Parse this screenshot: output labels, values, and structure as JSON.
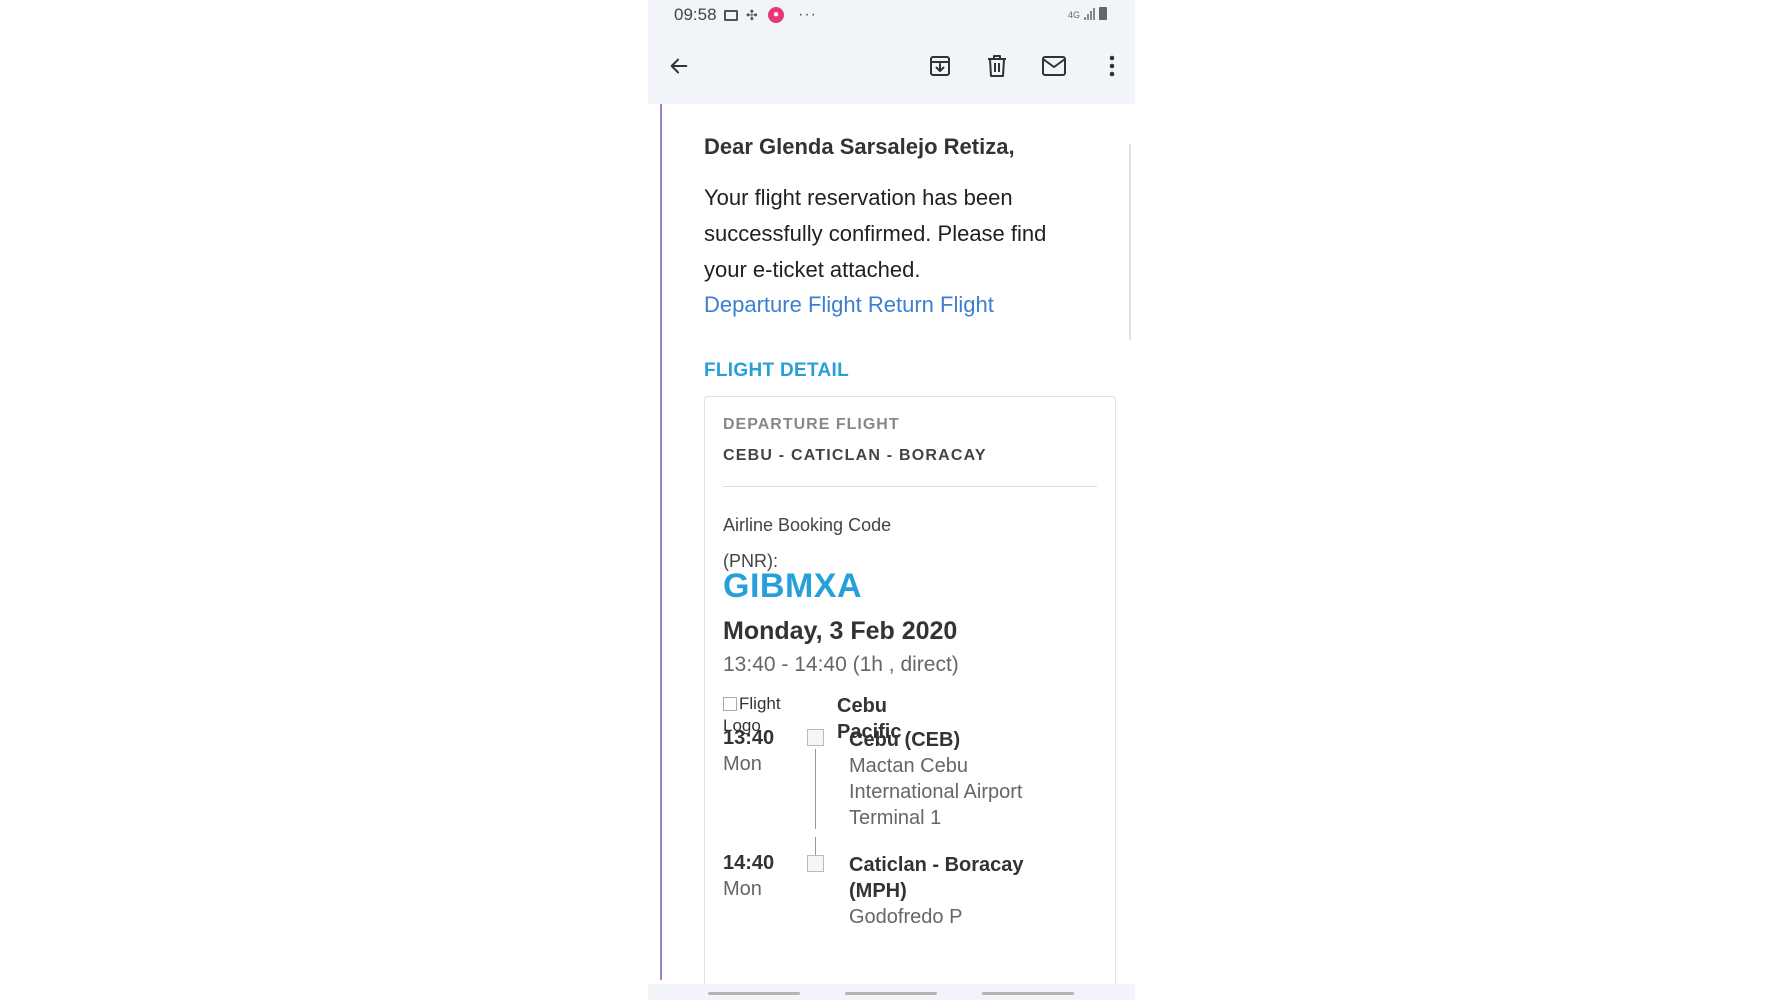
{
  "status_bar": {
    "time": "09:58",
    "network": "4G",
    "more": "···"
  },
  "toolbar": {
    "back": "arrow-left-icon",
    "archive": "archive-icon",
    "delete": "trash-icon",
    "mark_unread": "mail-icon",
    "more": "more-vert-icon"
  },
  "email": {
    "salutation": "Dear Glenda Sarsalejo Retiza,",
    "intro": "Your flight reservation has been successfully confirmed. Please find your e-ticket attached.",
    "links": [
      "Departure Flight",
      "Return Flight"
    ],
    "section_title": "FLIGHT DETAIL"
  },
  "flight": {
    "kicker": "DEPARTURE FLIGHT",
    "route": "CEBU - CATICLAN - BORACAY",
    "pnr_label": "Airline Booking Code (PNR):",
    "pnr_code": "GIBMXA",
    "date": "Monday, 3 Feb 2020",
    "times": "13:40 - 14:40 (1h , direct)",
    "logo_alt": "Flight Logo",
    "airline": "Cebu Pacific",
    "segments": [
      {
        "time": "13:40",
        "day": "Mon",
        "city": "Cebu (CEB)",
        "airport": "Mactan Cebu International Airport Terminal 1"
      },
      {
        "time": "14:40",
        "day": "Mon",
        "city": "Caticlan - Boracay (MPH)",
        "airport": "Godofredo P"
      }
    ]
  },
  "colors": {
    "accent": "#27a0d9",
    "link": "#3b7fd1",
    "thread_rule": "#9a82c9",
    "toolbar_bg": "#f1f4f9"
  }
}
